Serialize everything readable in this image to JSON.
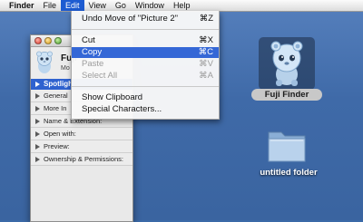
{
  "menubar": {
    "app": "Finder",
    "items": [
      "File",
      "Edit",
      "View",
      "Go",
      "Window",
      "Help"
    ],
    "active": "Edit",
    "highlight_color": "#1d5bd1"
  },
  "edit_menu": {
    "undo": {
      "label": "Undo Move of \"Picture 2\"",
      "shortcut": "⌘Z"
    },
    "cut": {
      "label": "Cut",
      "shortcut": "⌘X"
    },
    "copy": {
      "label": "Copy",
      "shortcut": "⌘C"
    },
    "paste": {
      "label": "Paste",
      "shortcut": "⌘V"
    },
    "select_all": {
      "label": "Select All",
      "shortcut": "⌘A"
    },
    "show_clipboard": {
      "label": "Show Clipboard"
    },
    "special_characters": {
      "label": "Special Characters..."
    },
    "selected_item": "Copy"
  },
  "info_window": {
    "name": "Fuji",
    "kind": "Mo",
    "spotlight_label": "Spotligh",
    "sections": [
      "General",
      "More In",
      "Name & Extension:",
      "Open with:",
      "Preview:",
      "Ownership & Permissions:"
    ]
  },
  "desktop": {
    "icons": [
      {
        "label": "Fuji Finder",
        "icon": "fuji-finder-app-icon",
        "selected": true
      },
      {
        "label": "untitled folder",
        "icon": "folder-icon",
        "selected": false
      }
    ],
    "background_color": "#3b6aa8"
  }
}
